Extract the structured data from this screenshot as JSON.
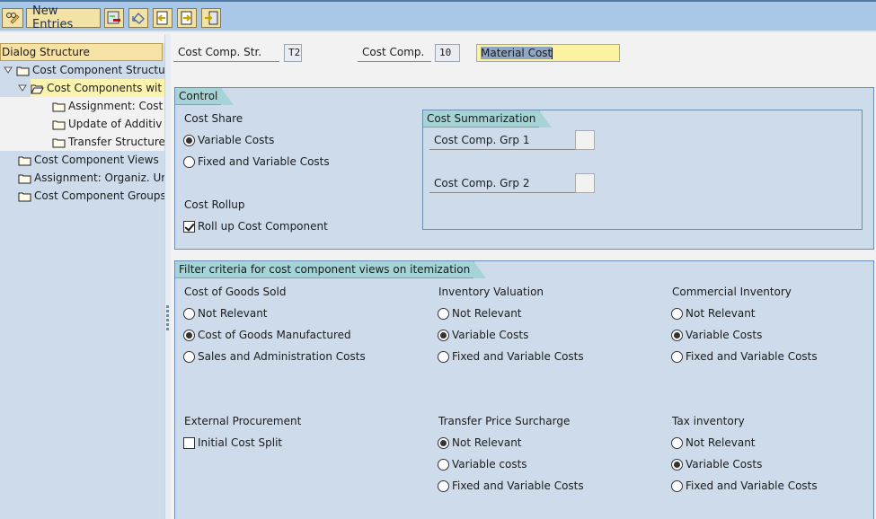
{
  "toolbar": {
    "buttons": [
      {
        "icon": "change-display-icon"
      },
      {
        "label": "New Entries"
      },
      {
        "icon": "delete-icon"
      },
      {
        "icon": "undo-icon"
      },
      {
        "icon": "previous-entry-icon"
      },
      {
        "icon": "next-entry-icon"
      },
      {
        "icon": "select-all-icon"
      }
    ]
  },
  "sidebar": {
    "title": "Dialog Structure",
    "items": [
      {
        "label": "Cost Component Structu",
        "level": 0,
        "expanded": true
      },
      {
        "label": "Cost Components wit",
        "level": 1,
        "expanded": true,
        "selected": true
      },
      {
        "label": "Assignment: Cost",
        "level": 2
      },
      {
        "label": "Update of Additiv",
        "level": 2
      },
      {
        "label": "Transfer Structure",
        "level": 2
      },
      {
        "label": "Cost Component Views",
        "level": 0
      },
      {
        "label": "Assignment: Organiz. Ur",
        "level": 0
      },
      {
        "label": "Cost Component Groups",
        "level": 0
      }
    ]
  },
  "header": {
    "cost_comp_str_label": "Cost Comp. Str.",
    "cost_comp_str_value": "T2",
    "cost_comp_label": "Cost Comp.",
    "cost_comp_value": "10",
    "description_value": "Material Cost"
  },
  "control": {
    "title": "Control",
    "cost_share": {
      "label": "Cost Share",
      "options": [
        {
          "label": "Variable Costs",
          "selected": true
        },
        {
          "label": "Fixed and Variable Costs",
          "selected": false
        }
      ]
    },
    "cost_rollup": {
      "label": "Cost Rollup",
      "checkbox_label": "Roll up Cost Component",
      "checked": true
    },
    "cost_summarization": {
      "title": "Cost Summarization",
      "grp1_label": "Cost Comp. Grp 1",
      "grp1_value": "",
      "grp2_label": "Cost Comp. Grp 2",
      "grp2_value": ""
    }
  },
  "filter": {
    "title": "Filter criteria for cost component views on itemization",
    "cost_of_goods_sold": {
      "label": "Cost of Goods Sold",
      "options": [
        {
          "label": "Not Relevant",
          "selected": false
        },
        {
          "label": "Cost of Goods Manufactured",
          "selected": true
        },
        {
          "label": "Sales and Administration Costs",
          "selected": false
        }
      ]
    },
    "inventory_valuation": {
      "label": "Inventory Valuation",
      "options": [
        {
          "label": "Not Relevant",
          "selected": false
        },
        {
          "label": "Variable Costs",
          "selected": true
        },
        {
          "label": "Fixed and Variable Costs",
          "selected": false
        }
      ]
    },
    "commercial_inventory": {
      "label": "Commercial Inventory",
      "options": [
        {
          "label": "Not Relevant",
          "selected": false
        },
        {
          "label": "Variable Costs",
          "selected": true
        },
        {
          "label": "Fixed and Variable Costs",
          "selected": false
        }
      ]
    },
    "external_procurement": {
      "label": "External Procurement",
      "checkbox_label": "Initial Cost Split",
      "checked": false
    },
    "transfer_price_surcharge": {
      "label": "Transfer Price Surcharge",
      "options": [
        {
          "label": "Not Relevant",
          "selected": true
        },
        {
          "label": "Variable costs",
          "selected": false
        },
        {
          "label": "Fixed and Variable Costs",
          "selected": false
        }
      ]
    },
    "tax_inventory": {
      "label": "Tax inventory",
      "options": [
        {
          "label": "Not Relevant",
          "selected": false
        },
        {
          "label": "Variable Costs",
          "selected": true
        },
        {
          "label": "Fixed and Variable Costs",
          "selected": false
        }
      ]
    }
  }
}
